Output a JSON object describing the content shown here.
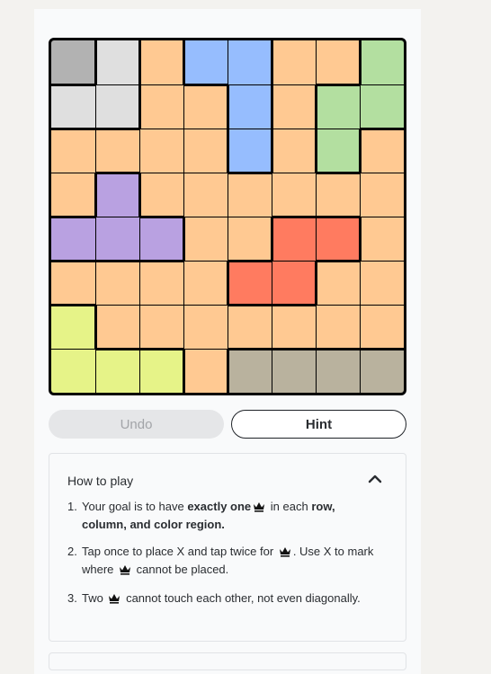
{
  "board": {
    "size": 8,
    "regions": [
      [
        "gray",
        "lightgray",
        "orange",
        "blue",
        "blue",
        "orange",
        "orange",
        "green"
      ],
      [
        "lightgray",
        "lightgray",
        "orange",
        "orange",
        "blue",
        "orange",
        "green",
        "green"
      ],
      [
        "orange",
        "orange",
        "orange",
        "orange",
        "blue",
        "orange",
        "green",
        "orange"
      ],
      [
        "orange",
        "purple",
        "orange",
        "orange",
        "orange",
        "orange",
        "orange",
        "orange"
      ],
      [
        "purple",
        "purple",
        "purple",
        "orange",
        "orange",
        "red",
        "red",
        "orange"
      ],
      [
        "orange",
        "orange",
        "orange",
        "orange",
        "red",
        "red",
        "orange",
        "orange"
      ],
      [
        "yellow",
        "orange",
        "orange",
        "orange",
        "orange",
        "orange",
        "orange",
        "orange"
      ],
      [
        "yellow",
        "yellow",
        "yellow",
        "orange",
        "taupe",
        "taupe",
        "taupe",
        "taupe"
      ]
    ]
  },
  "buttons": {
    "undo": "Undo",
    "hint": "Hint"
  },
  "howto": {
    "title": "How to play",
    "steps": [
      {
        "num": "1.",
        "parts": [
          {
            "t": "Your goal is to have "
          },
          {
            "t": "exactly one",
            "b": true
          },
          {
            "crown": true
          },
          {
            "t": " in each "
          },
          {
            "t": "row, column, and color region.",
            "b": true
          }
        ]
      },
      {
        "num": "2.",
        "parts": [
          {
            "t": "Tap once to place X and tap twice for "
          },
          {
            "crown": true
          },
          {
            "t": ". Use X to mark where "
          },
          {
            "crown": true
          },
          {
            "t": " cannot be placed."
          }
        ]
      },
      {
        "num": "3.",
        "parts": [
          {
            "t": "Two "
          },
          {
            "crown": true
          },
          {
            "t": " cannot touch each other, not even diagonally."
          }
        ]
      }
    ]
  }
}
